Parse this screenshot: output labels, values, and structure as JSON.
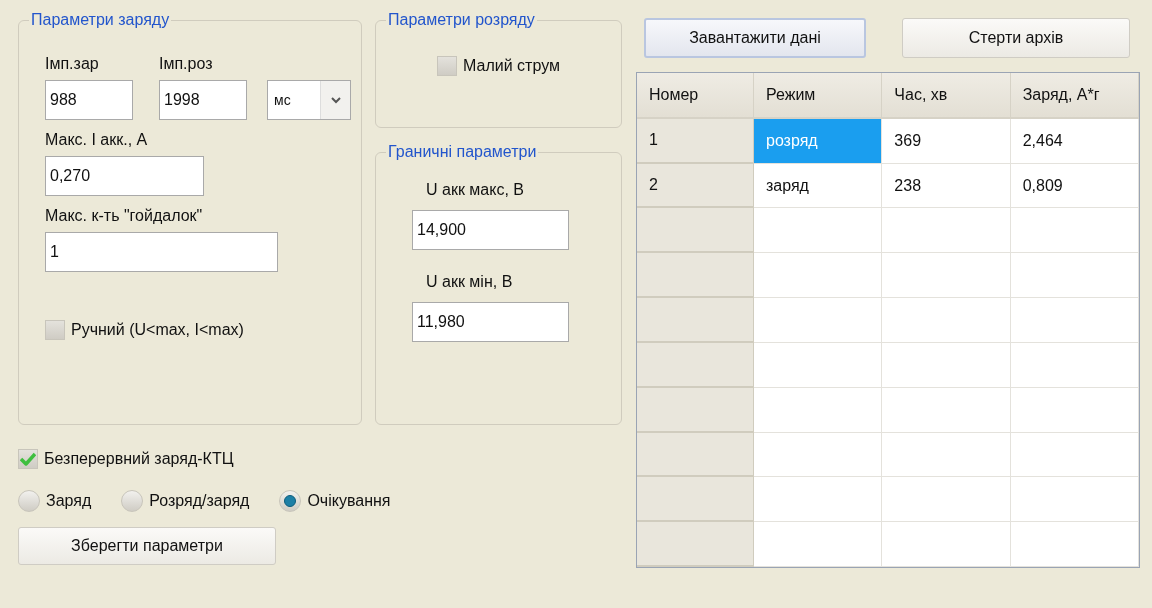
{
  "charge_params": {
    "title": "Параметри заряду",
    "pulse_charge": {
      "label": "Імп.зар",
      "value": "988"
    },
    "pulse_discharge": {
      "label": "Імп.роз",
      "value": "1998"
    },
    "unit_select": {
      "value": "мс"
    },
    "max_current": {
      "label": "Макс. I акк., А",
      "value": "0,270"
    },
    "max_swings": {
      "label": "Макс. к-ть \"гойдалок\"",
      "value": "1"
    },
    "manual": {
      "label": "Ручний (U<max, I<max)",
      "checked": false
    }
  },
  "discharge_params": {
    "title": "Параметри розряду",
    "low_current": {
      "label": "Малий струм",
      "checked": false
    }
  },
  "limits": {
    "title": "Граничні параметри",
    "u_max": {
      "label": "U акк макс, В",
      "value": "14,900"
    },
    "u_min": {
      "label": "U акк мін, В",
      "value": "11,980"
    }
  },
  "continuous": {
    "label": "Безперервний заряд-КТЦ",
    "checked": true
  },
  "modes": [
    {
      "label": "Заряд",
      "selected": false
    },
    {
      "label": "Розряд/заряд",
      "selected": false
    },
    {
      "label": "Очікування",
      "selected": true
    }
  ],
  "save_button": "Зберегти параметри",
  "load_button": "Завантажити дані",
  "erase_button": "Стерти архів",
  "table": {
    "columns": [
      "Номер",
      "Режим",
      "Час, хв",
      "Заряд, А*г"
    ],
    "rows": [
      {
        "cells": [
          {
            "text": "1",
            "selected": false
          },
          {
            "text": "розряд",
            "selected": true
          },
          {
            "text": "369",
            "selected": false
          },
          {
            "text": "2,464",
            "selected": false
          }
        ]
      },
      {
        "cells": [
          {
            "text": "2",
            "selected": false
          },
          {
            "text": "заряд",
            "selected": false
          },
          {
            "text": "238",
            "selected": false
          },
          {
            "text": "0,809",
            "selected": false
          }
        ]
      }
    ]
  }
}
